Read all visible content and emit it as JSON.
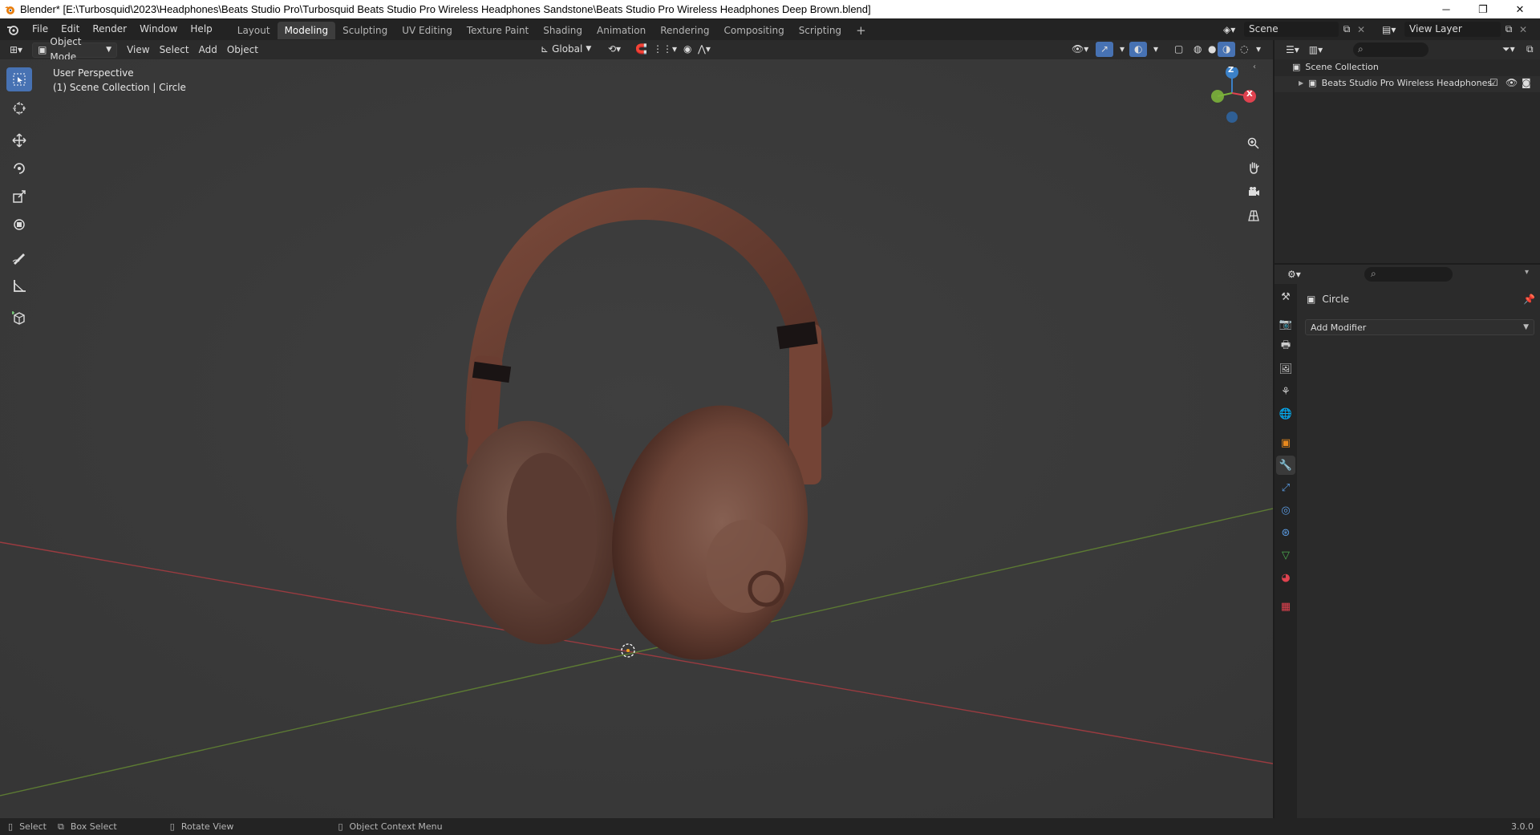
{
  "title_bar": {
    "title": "Blender* [E:\\Turbosquid\\2023\\Headphones\\Beats Studio Pro\\Turbosquid Beats Studio Pro Wireless Headphones Sandstone\\Beats Studio Pro Wireless Headphones Deep Brown.blend]",
    "minimize": "─",
    "restore": "❐",
    "close": "✕"
  },
  "menu": [
    "File",
    "Edit",
    "Render",
    "Window",
    "Help"
  ],
  "workspace_tabs": [
    "Layout",
    "Modeling",
    "Sculpting",
    "UV Editing",
    "Texture Paint",
    "Shading",
    "Animation",
    "Rendering",
    "Compositing",
    "Scripting"
  ],
  "workspace_active": "Modeling",
  "workspace_add": "+",
  "scene": {
    "label": "Scene"
  },
  "view_layer": {
    "label": "View Layer"
  },
  "viewport_header": {
    "mode": "Object Mode",
    "menus": [
      "View",
      "Select",
      "Add",
      "Object"
    ],
    "orientation": "Global"
  },
  "viewport": {
    "perspective": "User Perspective",
    "collection": "(1) Scene Collection | Circle",
    "gizmo": {
      "z": "Z",
      "x": "X",
      "y": "Y"
    },
    "colors": {
      "x_axis": "#e0424f",
      "y_axis": "#7cb33b",
      "z_axis": "#3b81c8",
      "headphone": "#6d3e31"
    }
  },
  "outliner": {
    "root": "Scene Collection",
    "items": [
      {
        "label": "Beats Studio Pro Wireless Headphones"
      }
    ]
  },
  "properties": {
    "object_name": "Circle",
    "add_modifier": "Add Modifier"
  },
  "status_bar": {
    "select": "Select",
    "box_select": "Box Select",
    "rotate": "Rotate View",
    "context_menu": "Object Context Menu",
    "version": "3.0.0"
  }
}
